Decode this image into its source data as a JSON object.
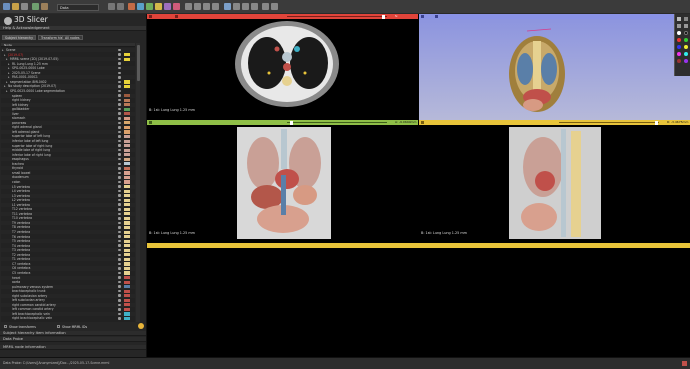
{
  "app": {
    "title": "3D Slicer"
  },
  "toolbar": {
    "module_selector": "Data"
  },
  "left_panel": {
    "help_bar": "Help & Acknowledgement",
    "tabs": [
      "Subject hierarchy",
      "Transform hierarchy",
      "All nodes"
    ],
    "tree_header": "Node",
    "tree_items": [
      {
        "label": "Scene",
        "color": ""
      },
      {
        "label": "(2019-07)",
        "color": "#e8d23a"
      },
      {
        "label": "MRML scene (2D) (2019-07-05)",
        "color": "#e8d23a"
      },
      {
        "label": "RL Lung Lung 1.25 mm",
        "color": ""
      },
      {
        "label": "SPG-0025-0000 Lobe",
        "color": ""
      },
      {
        "label": "2025-05-17 Scene",
        "color": ""
      },
      {
        "label": "PAS-0001-000C1",
        "color": ""
      },
      {
        "label": "segmentation 8ML0402",
        "color": "#e8d23a"
      },
      {
        "label": "No study description (2019-07)",
        "color": "#e8d23a"
      },
      {
        "label": "SPG-0025-0000 Lobe segmentation",
        "color": ""
      },
      {
        "label": "spleen",
        "color": "#9c5a3e"
      },
      {
        "label": "right kidney",
        "color": "#b97a58"
      },
      {
        "label": "left kidney",
        "color": "#b97a58"
      },
      {
        "label": "gallbladder",
        "color": "#58a05a"
      },
      {
        "label": "liver",
        "color": "#b3574a"
      },
      {
        "label": "stomach",
        "color": "#d79a83"
      },
      {
        "label": "pancreas",
        "color": "#d6a66c"
      },
      {
        "label": "right adrenal gland",
        "color": "#dca06b"
      },
      {
        "label": "left adrenal gland",
        "color": "#dca06b"
      },
      {
        "label": "superior lobe of left lung",
        "color": "#c9a096"
      },
      {
        "label": "inferior lobe of left lung",
        "color": "#c9a096"
      },
      {
        "label": "superior lobe of right lung",
        "color": "#c9a096"
      },
      {
        "label": "middle lobe of right lung",
        "color": "#c9a096"
      },
      {
        "label": "inferior lobe of right lung",
        "color": "#c9a096"
      },
      {
        "label": "esophagus",
        "color": "#d3a883"
      },
      {
        "label": "trachea",
        "color": "#b8c7d0"
      },
      {
        "label": "thyroid",
        "color": "#c56f57"
      },
      {
        "label": "small bowel",
        "color": "#d8a08e"
      },
      {
        "label": "duodenum",
        "color": "#d8a08e"
      },
      {
        "label": "colon",
        "color": "#d8a08e"
      },
      {
        "label": "L5 vertebra",
        "color": "#e6d190"
      },
      {
        "label": "L4 vertebra",
        "color": "#e6d190"
      },
      {
        "label": "L3 vertebra",
        "color": "#e6d190"
      },
      {
        "label": "L2 vertebra",
        "color": "#e6d190"
      },
      {
        "label": "L1 vertebra",
        "color": "#e6d190"
      },
      {
        "label": "T12 vertebra",
        "color": "#e6d190"
      },
      {
        "label": "T11 vertebra",
        "color": "#e6d190"
      },
      {
        "label": "T10 vertebra",
        "color": "#e6d190"
      },
      {
        "label": "T9 vertebra",
        "color": "#e6d190"
      },
      {
        "label": "T8 vertebra",
        "color": "#e6d190"
      },
      {
        "label": "T7 vertebra",
        "color": "#e6d190"
      },
      {
        "label": "T6 vertebra",
        "color": "#e6d190"
      },
      {
        "label": "T5 vertebra",
        "color": "#e6d190"
      },
      {
        "label": "T4 vertebra",
        "color": "#e6d190"
      },
      {
        "label": "T3 vertebra",
        "color": "#e6d190"
      },
      {
        "label": "T2 vertebra",
        "color": "#e6d190"
      },
      {
        "label": "T1 vertebra",
        "color": "#e6d190"
      },
      {
        "label": "C7 vertebra",
        "color": "#e6d190"
      },
      {
        "label": "C6 vertebra",
        "color": "#e6d190"
      },
      {
        "label": "C5 vertebra",
        "color": "#e6d190"
      },
      {
        "label": "heart",
        "color": "#c0504a"
      },
      {
        "label": "aorta",
        "color": "#c0504a"
      },
      {
        "label": "pulmonary venous system",
        "color": "#5a7fa8"
      },
      {
        "label": "brachiocephalic trunk",
        "color": "#c0504a"
      },
      {
        "label": "right subclavian artery",
        "color": "#c0504a"
      },
      {
        "label": "left subclavian artery",
        "color": "#c0504a"
      },
      {
        "label": "right common carotid artery",
        "color": "#c0504a"
      },
      {
        "label": "left common carotid artery",
        "color": "#c0504a"
      },
      {
        "label": "left brachiocephalic vein",
        "color": "#3fb0c6"
      },
      {
        "label": "right brachiocephalic vein",
        "color": "#3fb0c6"
      }
    ],
    "show_transforms": "Show transforms",
    "show_mrml_ids": "Show MRML IDs",
    "subject_hierarchy_info": "Subject hierarchy item information",
    "data_probe": "Data Probe",
    "mrml_node_info": "MRML node information"
  },
  "views": {
    "red_label": "B: 1st: Lung Lung 1.25 mm",
    "green_label": "B: 1st: Lung Lung 1.25 mm",
    "yellow_label": "B: 1st: Lung Lung 1.25 mm",
    "red_offset": "S: -51.5985mm",
    "green_offset": "A: -9.0640mm",
    "yellow_offset": "R: -3.4675mm",
    "colors": {
      "red": "#e0443a",
      "green": "#8fbf47",
      "yellow": "#e8c43a",
      "blue3d": "#8a93e6"
    }
  },
  "status": {
    "text": "Data Probe: C:/Users/[Anonymized]/Doc.../2025-05-17-Scene.mrml"
  }
}
